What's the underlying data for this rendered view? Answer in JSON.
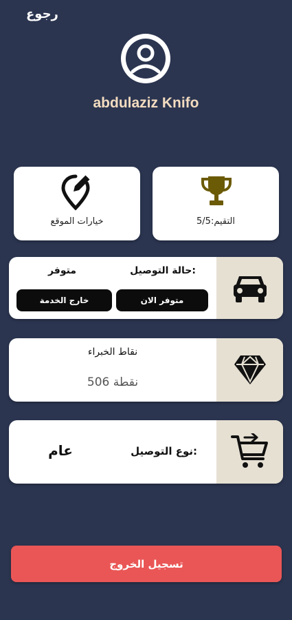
{
  "header": {
    "back_label": "رجوع"
  },
  "profile": {
    "name": "abdulaziz Knifo"
  },
  "tiles": {
    "rating_label": "التقيم:5/5",
    "location_label": "خيارات الموقع"
  },
  "delivery_status": {
    "label": "حالة التوصيل:",
    "value": "متوفر",
    "available_button": "متوفر الان",
    "out_of_service_button": "خارج الخدمة"
  },
  "points": {
    "label": "نقاط الخبراء",
    "value": "506 نقطة"
  },
  "delivery_type": {
    "label": "نوع التوصيل:",
    "value": "عام"
  },
  "footer": {
    "logout_label": "تسجيل الخروج"
  },
  "colors": {
    "background": "#2b3550",
    "card": "#ffffff",
    "icon_box": "#e6e0d3",
    "trophy": "#6b5a06",
    "logout": "#ea5656",
    "name": "#f3dcc0"
  },
  "icons": {
    "avatar": "user-circle-icon",
    "rating": "trophy-icon",
    "location": "location-edit-icon",
    "status": "car-icon",
    "points": "diamond-icon",
    "type": "cart-arrow-icon"
  }
}
